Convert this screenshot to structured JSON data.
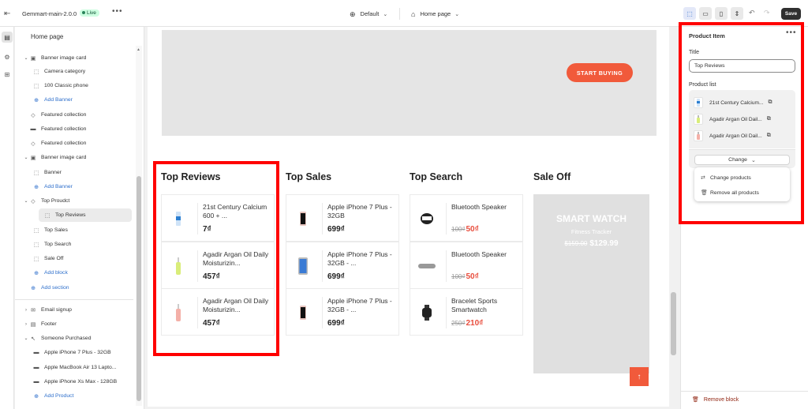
{
  "topbar": {
    "app_name": "Gemmart-main-2.0.0",
    "status": "Live",
    "more": "•••",
    "theme": "Default",
    "page": "Home page",
    "save": "Save"
  },
  "sidebar": {
    "title": "Home page",
    "items": [
      {
        "label": "Banner image card",
        "icon": "image-icon",
        "caret": "chevron-down"
      },
      {
        "label": "Camera category",
        "icon": "block-icon",
        "indent": 2
      },
      {
        "label": "100 Classic phone",
        "icon": "block-icon",
        "indent": 2
      },
      {
        "label": "Add Banner",
        "icon": "plus-circle-icon",
        "indent": 2,
        "add": true
      },
      {
        "label": "Featured collection",
        "icon": "tag-icon"
      },
      {
        "label": "Featured collection",
        "icon": "divider-icon"
      },
      {
        "label": "Featured collection",
        "icon": "tag-icon"
      },
      {
        "label": "Banner image card",
        "icon": "image-icon",
        "caret": "chevron-down"
      },
      {
        "label": "Banner",
        "icon": "block-icon",
        "indent": 2
      },
      {
        "label": "Add Banner",
        "icon": "plus-circle-icon",
        "indent": 2,
        "add": true
      },
      {
        "label": "Top Proudct",
        "icon": "tag-icon",
        "caret": "chevron-down"
      },
      {
        "label": "Top Reviews",
        "icon": "block-icon",
        "indent": 2,
        "selected": true
      },
      {
        "label": "Top Sales",
        "icon": "block-icon",
        "indent": 2
      },
      {
        "label": "Top Search",
        "icon": "block-icon",
        "indent": 2
      },
      {
        "label": "Sale Off",
        "icon": "block-icon",
        "indent": 2
      },
      {
        "label": "Add block",
        "icon": "plus-circle-icon",
        "indent": 2,
        "add": true
      },
      {
        "label": "Add section",
        "icon": "plus-circle-icon",
        "indent": 1,
        "add": true
      },
      {
        "label": "Email signup",
        "icon": "mail-icon",
        "caret": "chevron-right"
      },
      {
        "label": "Footer",
        "icon": "footer-icon",
        "caret": "chevron-right"
      },
      {
        "label": "Someone Purchased",
        "icon": "cursor-icon",
        "caret": "chevron-down"
      },
      {
        "label": "Apple iPhone 7 Plus - 32GB",
        "icon": "product-icon",
        "indent": 2
      },
      {
        "label": "Apple MacBook Air 13 Lapto...",
        "icon": "product-icon",
        "indent": 2
      },
      {
        "label": "Apple iPhone Xs Max - 128GB",
        "icon": "product-icon",
        "indent": 2
      },
      {
        "label": "Add Product",
        "icon": "plus-circle-icon",
        "indent": 2,
        "add": true
      }
    ]
  },
  "canvas": {
    "banner_button": "START BUYING",
    "columns": [
      {
        "title": "Top Reviews",
        "products": [
          {
            "name": "21st Century Calcium 600 + ...",
            "price": "7₫"
          },
          {
            "name": "Agadir Argan Oil Daily Moisturizin...",
            "price": "457₫"
          },
          {
            "name": "Agadir Argan Oil Daily Moisturizin...",
            "price": "457₫"
          }
        ]
      },
      {
        "title": "Top Sales",
        "products": [
          {
            "name": "Apple iPhone 7 Plus - 32GB",
            "price": "699₫"
          },
          {
            "name": "Apple iPhone 7 Plus - 32GB - ...",
            "price": "699₫"
          },
          {
            "name": "Apple iPhone 7 Plus - 32GB - ...",
            "price": "699₫"
          }
        ]
      },
      {
        "title": "Top Search",
        "products": [
          {
            "name": "Bluetooth Speaker",
            "old_price": "100₫",
            "price": "50₫"
          },
          {
            "name": "Bluetooth Speaker",
            "old_price": "100₫",
            "price": "50₫"
          },
          {
            "name": "Bracelet Sports Smartwatch",
            "old_price": "250₫",
            "price": "210₫"
          }
        ]
      },
      {
        "title": "Sale Off",
        "promo": {
          "heading": "SMART WATCH",
          "subheading": "Fitness Tracker",
          "old_price": "$159.00",
          "price": "$129.99"
        }
      }
    ]
  },
  "panel": {
    "title": "Product Item",
    "more": "•••",
    "title_label": "Title",
    "title_value": "Top Reviews",
    "list_label": "Product list",
    "products": [
      "21st Century Calcium...",
      "Agadir Argan Oil Dail...",
      "Agadir Argan Oil Dail..."
    ],
    "change_button": "Change",
    "menu": [
      "Change products",
      "Remove all products"
    ],
    "remove_block": "Remove block"
  },
  "colors": {
    "accent": "#f15a3b",
    "sale_price": "#e84d3d",
    "highlight": "#ff0000",
    "link": "#2c6ecb",
    "danger": "#8e1f0b"
  }
}
